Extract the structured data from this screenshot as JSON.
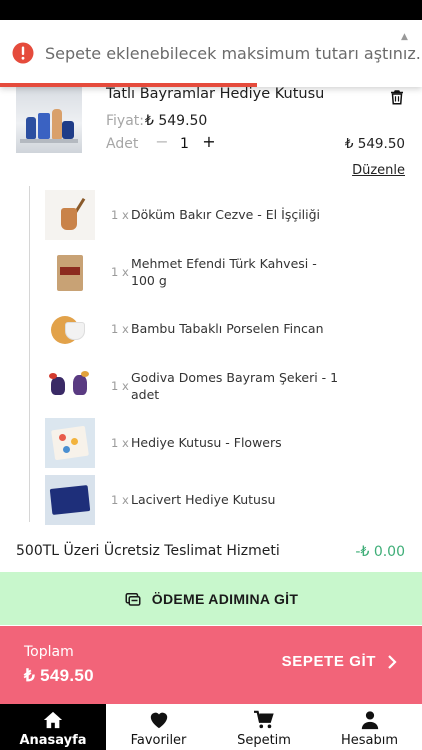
{
  "toast": {
    "message": "Sepete eklenebilecek maksimum tutarı aştınız.",
    "close_glyph": "▲",
    "progress": 0.61,
    "color": "#e54b3c"
  },
  "product": {
    "title": "Tatlı Bayramlar Hediye Kutusu",
    "price_label": "Fiyat:",
    "price": "₺ 549.50",
    "qty_label": "Adet",
    "qty_minus": "−",
    "qty": "1",
    "qty_plus": "+",
    "line_total": "₺ 549.50",
    "edit_label": "Düzenle"
  },
  "bundle_items": [
    {
      "qty": "1 x",
      "name": "Döküm Bakır Cezve - El İşçiliği"
    },
    {
      "qty": "1 x",
      "name": "Mehmet Efendi Türk Kahvesi - 100 g"
    },
    {
      "qty": "1 x",
      "name": "Bambu Tabaklı Porselen Fincan"
    },
    {
      "qty": "1 x",
      "name": "Godiva Domes Bayram Şekeri - 1 adet"
    },
    {
      "qty": "1 x",
      "name": "Hediye Kutusu - Flowers"
    },
    {
      "qty": "1 x",
      "name": "Lacivert Hediye Kutusu"
    }
  ],
  "delivery": {
    "label": "500TL Üzeri Ücretsiz Teslimat Hizmeti",
    "value": "-₺ 0.00"
  },
  "checkout": {
    "label": "ÖDEME ADIMINA GİT"
  },
  "totals": {
    "label": "Toplam",
    "value": "₺ 549.50",
    "go_cart_label": "SEPETE GİT"
  },
  "nav": {
    "items": [
      {
        "label": "Anasayfa",
        "icon": "home-icon",
        "active": true
      },
      {
        "label": "Favoriler",
        "icon": "heart-icon",
        "active": false
      },
      {
        "label": "Sepetim",
        "icon": "cart-icon",
        "active": false
      },
      {
        "label": "Hesabım",
        "icon": "account-icon",
        "active": false
      }
    ]
  },
  "colors": {
    "toast_progress": "#e54b3c",
    "checkout_bg": "#c8f7cc",
    "totals_bg": "#f26479",
    "delivery_value": "#3fae78",
    "nav_active_bg": "#000000"
  }
}
